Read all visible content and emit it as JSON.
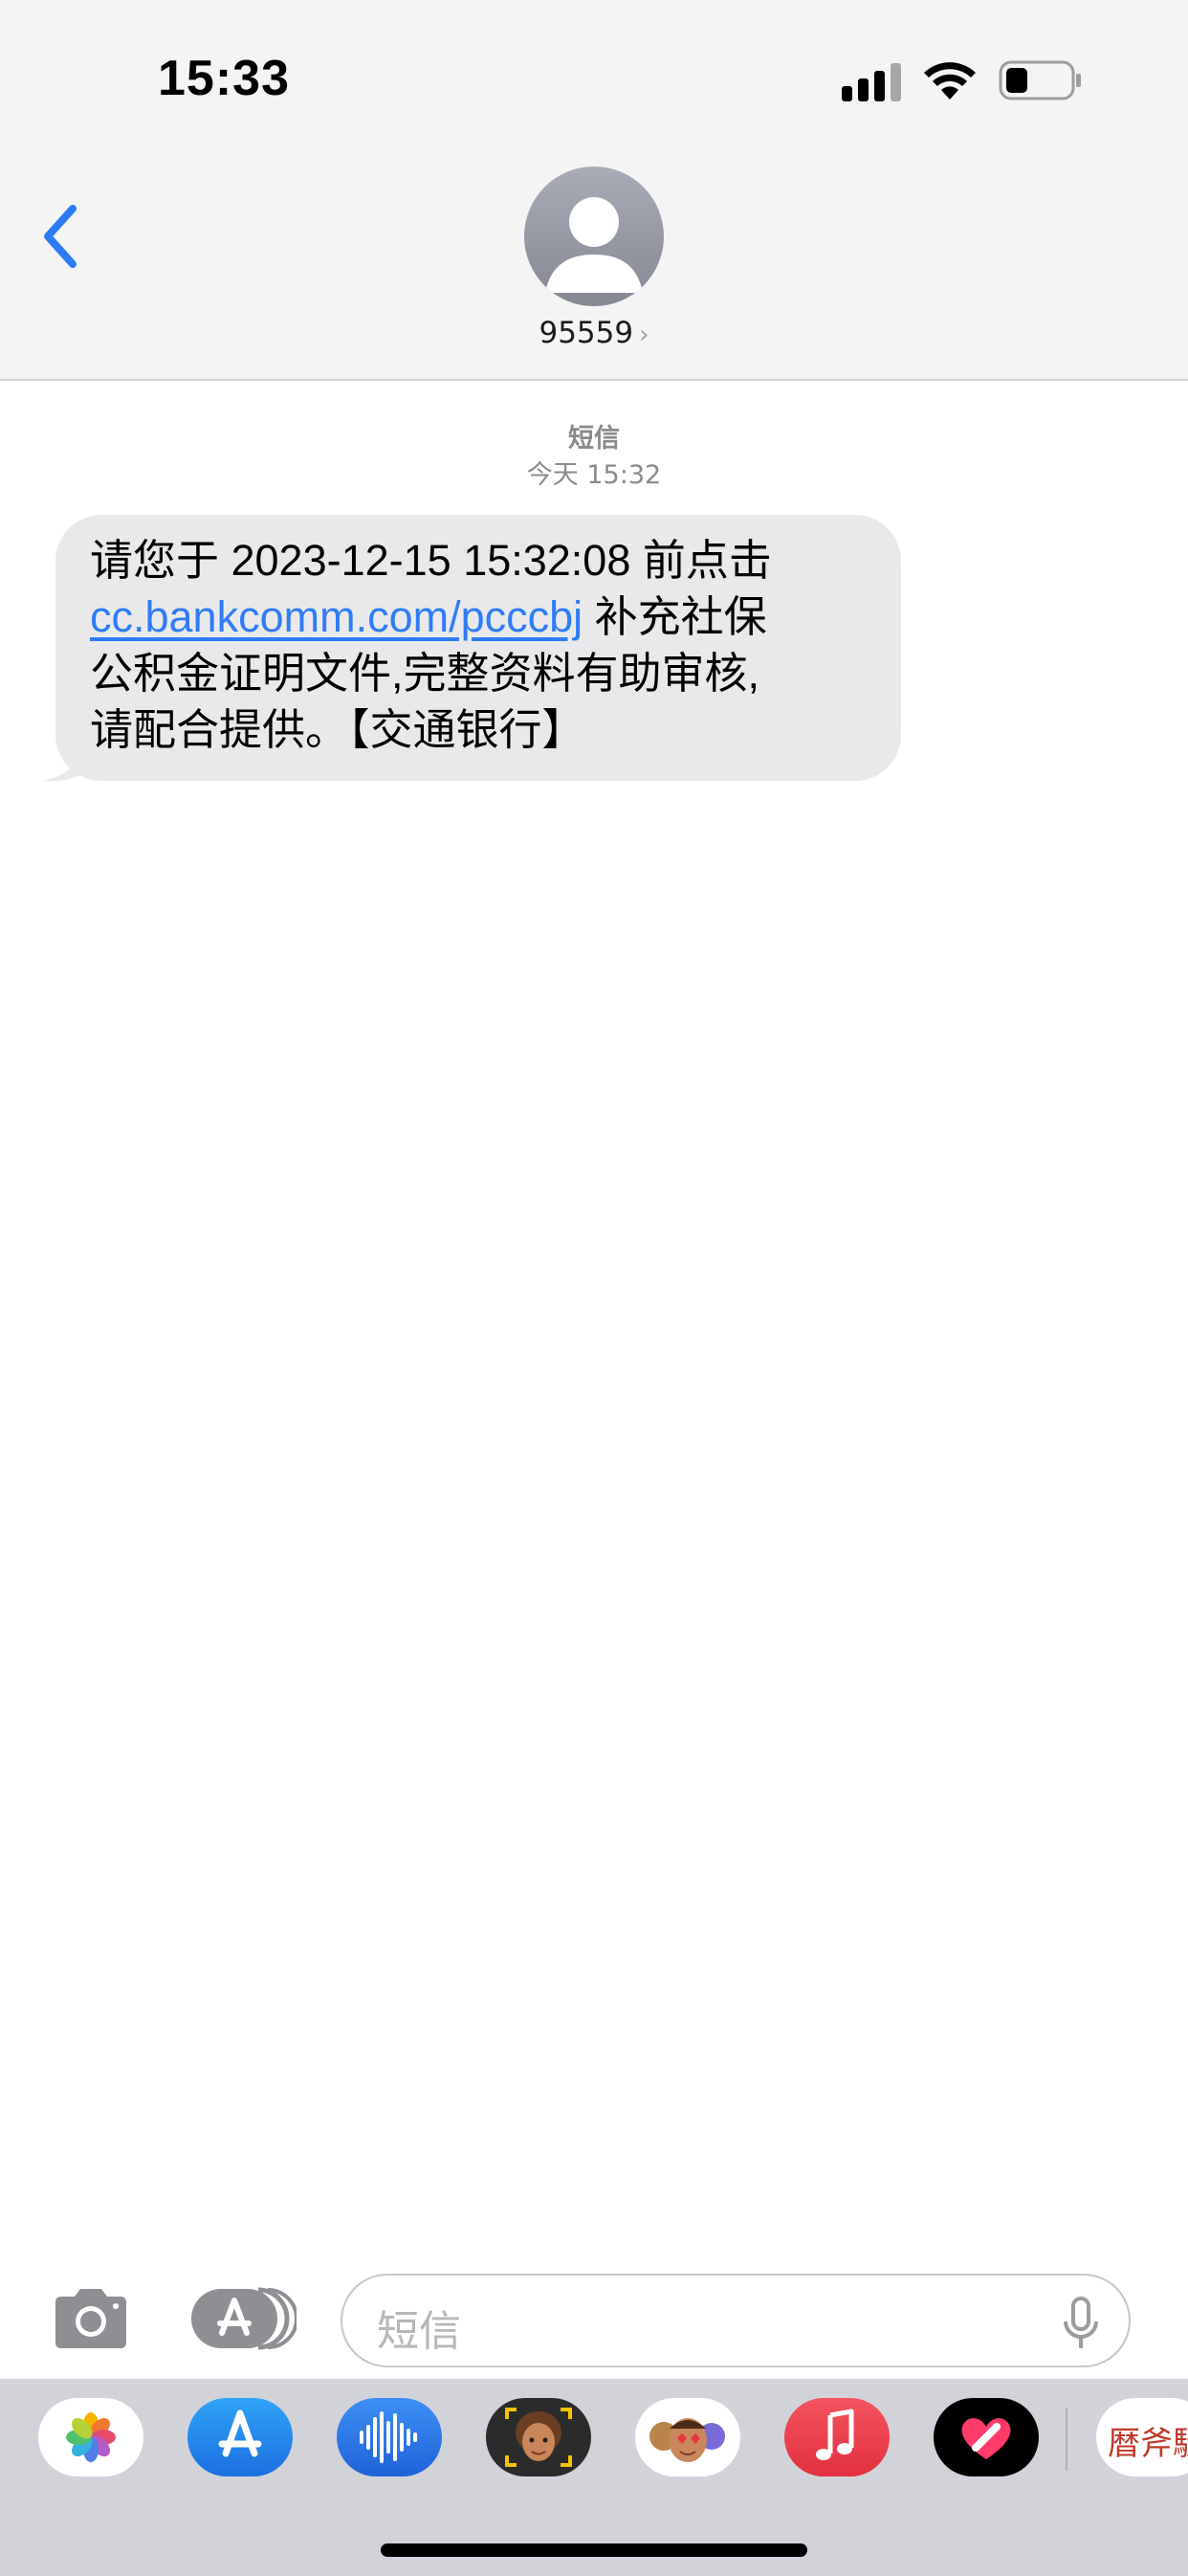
{
  "status_bar": {
    "time": "15:33"
  },
  "header": {
    "contact": "95559",
    "chevron": "›"
  },
  "conversation": {
    "service": "短信",
    "timestamp": "今天 15:32",
    "message": {
      "line1": "请您于 2023-12-15 15:32:08 前点击",
      "link": "cc.bankcomm.com/pcccbj",
      "line2_rest": " 补充社保",
      "line3": "公积金证明文件,完整资料有助审核,",
      "line4": "请配合提供。【交通银行】"
    }
  },
  "input": {
    "placeholder": "短信"
  },
  "drawer": {
    "apps": [
      "photos-app-icon",
      "app-store-icon",
      "audio-message-icon",
      "memoji-icon",
      "animoji-stickers-icon",
      "music-app-icon",
      "digital-touch-icon",
      "calendar-sticker-icon"
    ],
    "sticker_text": "暦斧騒"
  },
  "colors": {
    "link": "#2e7cf6",
    "back": "#2c7bf5",
    "bubble": "#e9e9eb",
    "music": "#ef3c4c"
  }
}
